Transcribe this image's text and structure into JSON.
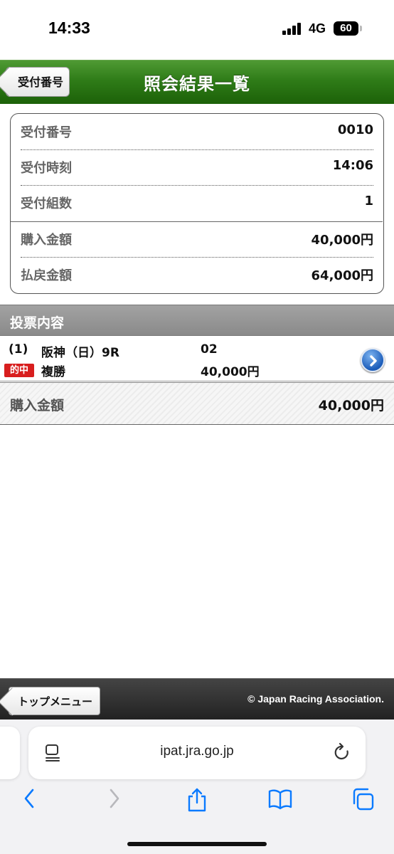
{
  "status_bar": {
    "time": "14:33",
    "network": "4G",
    "battery": "60"
  },
  "header": {
    "back_label": "受付番号",
    "title": "照会結果一覧"
  },
  "summary": {
    "rows": [
      {
        "label": "受付番号",
        "value": "0010"
      },
      {
        "label": "受付時刻",
        "value": "14:06"
      },
      {
        "label": "受付組数",
        "value": "1"
      },
      {
        "label": "購入金額",
        "value": "40,000円"
      },
      {
        "label": "払戻金額",
        "value": "64,000円"
      }
    ]
  },
  "section": {
    "title": "投票内容"
  },
  "bet": {
    "index": "(1)",
    "race": "阪神（日）9R",
    "number": "02",
    "hit_badge": "的中",
    "bet_type": "複勝",
    "amount": "40,000円"
  },
  "total": {
    "label": "購入金額",
    "value": "40,000円"
  },
  "footer": {
    "top_menu_label": "トップメニュー",
    "copyright": "© Japan Racing Association."
  },
  "browser": {
    "url": "ipat.jra.go.jp"
  },
  "colors": {
    "header_green": "#2f7c18",
    "hit_red": "#d81e1e",
    "link_blue": "#1b5cb9",
    "ios_blue": "#0a7aff"
  }
}
